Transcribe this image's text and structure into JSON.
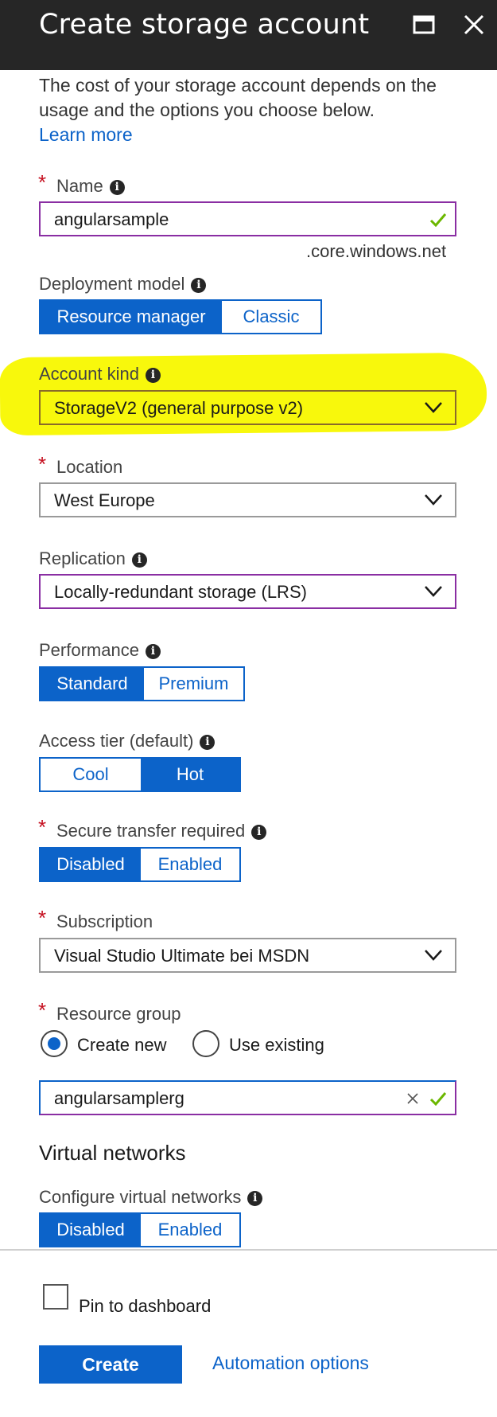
{
  "header": {
    "title": "Create storage account"
  },
  "intro": {
    "text": "The cost of your storage account depends on the usage and the options you choose below.",
    "learn_more": "Learn more"
  },
  "name": {
    "label": "Name",
    "value": "angularsample",
    "suffix": ".core.windows.net"
  },
  "deployment_model": {
    "label": "Deployment model",
    "options": [
      "Resource manager",
      "Classic"
    ],
    "selected": "Resource manager"
  },
  "account_kind": {
    "label": "Account kind",
    "value": "StorageV2 (general purpose v2)"
  },
  "location": {
    "label": "Location",
    "value": "West Europe"
  },
  "replication": {
    "label": "Replication",
    "value": "Locally-redundant storage (LRS)"
  },
  "performance": {
    "label": "Performance",
    "options": [
      "Standard",
      "Premium"
    ],
    "selected": "Standard"
  },
  "access_tier": {
    "label": "Access tier (default)",
    "options": [
      "Cool",
      "Hot"
    ],
    "selected": "Hot"
  },
  "secure_transfer": {
    "label": "Secure transfer required",
    "options": [
      "Disabled",
      "Enabled"
    ],
    "selected": "Disabled"
  },
  "subscription": {
    "label": "Subscription",
    "value": "Visual Studio Ultimate bei MSDN"
  },
  "resource_group": {
    "label": "Resource group",
    "create_new": "Create new",
    "use_existing": "Use existing",
    "selected": "Create new",
    "value": "angularsamplerg"
  },
  "virtual_networks": {
    "title": "Virtual networks",
    "label": "Configure virtual networks",
    "options": [
      "Disabled",
      "Enabled"
    ],
    "selected": "Disabled"
  },
  "footer": {
    "pin_label": "Pin to dashboard",
    "create_label": "Create",
    "automation_label": "Automation options"
  },
  "colors": {
    "accent": "#0c63c9",
    "header_bg": "#262626",
    "highlight": "#f8f80c",
    "valid_check": "#6bb700",
    "focus_border": "#8a2ea3",
    "required": "#c50f1f"
  }
}
